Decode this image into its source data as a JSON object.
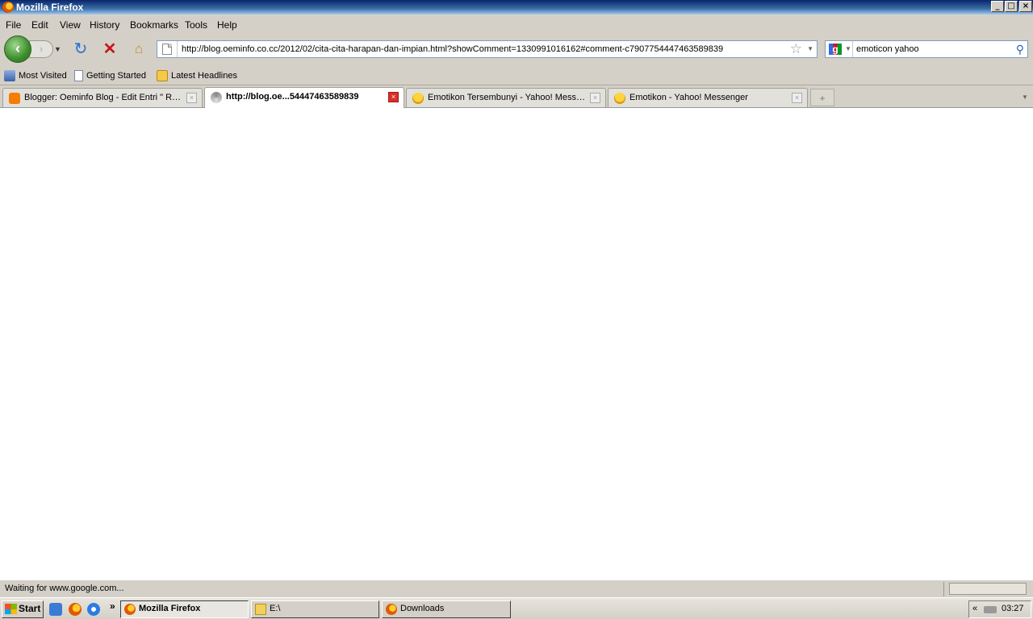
{
  "window": {
    "title": "Mozilla Firefox",
    "controls": [
      "_",
      "□",
      "×"
    ]
  },
  "menu": [
    {
      "label": "File"
    },
    {
      "label": "Edit"
    },
    {
      "label": "View"
    },
    {
      "label": "History"
    },
    {
      "label": "Bookmarks"
    },
    {
      "label": "Tools"
    },
    {
      "label": "Help"
    }
  ],
  "nav": {
    "back_icon": "‹",
    "forward_icon": "›",
    "url": "http://blog.oeminfo.co.cc/2012/02/cita-cita-harapan-dan-impian.html?showComment=1330991016162#comment-c7907754447463589839",
    "search_value": "emoticon yahoo"
  },
  "bookmarks": [
    {
      "label": "Most Visited"
    },
    {
      "label": "Getting Started"
    },
    {
      "label": "Latest Headlines"
    }
  ],
  "tabs": [
    {
      "label": "Blogger: Oeminfo Blog - Edit Entri \" Rar..."
    },
    {
      "label": "http://blog.oe...54447463589839"
    },
    {
      "label": "Emotikon Tersembunyi - Yahoo! Messe..."
    },
    {
      "label": "Emotikon - Yahoo! Messenger"
    }
  ],
  "status": {
    "text": "Waiting for www.google.com..."
  },
  "taskbar": {
    "start": "Start",
    "tasks": [
      {
        "label": "Mozilla Firefox"
      },
      {
        "label": "E:\\"
      },
      {
        "label": "Downloads"
      }
    ],
    "clock": "03:27",
    "tray_arrow": "«",
    "chevron": "»"
  }
}
